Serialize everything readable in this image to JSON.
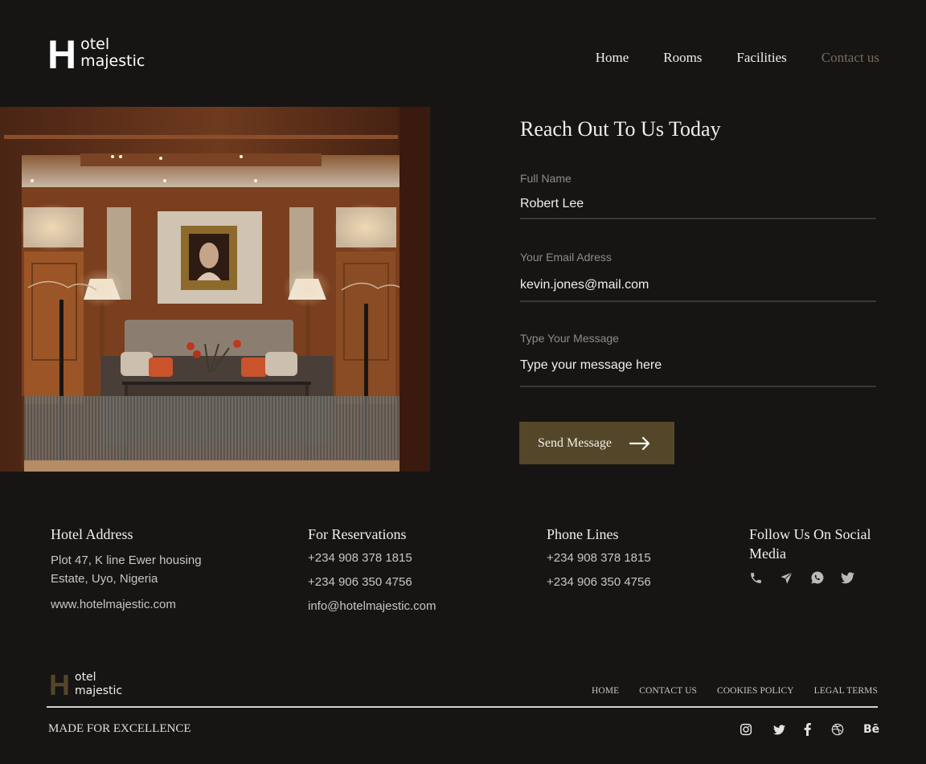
{
  "brand": {
    "logo_letter": "H",
    "logo_line1": "otel",
    "logo_line2": "majestic",
    "accent_color": "#544729",
    "active_nav_color": "#7a6a58",
    "background_color": "#161514"
  },
  "nav": {
    "items": [
      {
        "label": "Home",
        "active": false
      },
      {
        "label": "Rooms",
        "active": false
      },
      {
        "label": "Facilities",
        "active": false
      },
      {
        "label": "Contact us",
        "active": true
      }
    ]
  },
  "hero": {
    "image_description": "Warm wood-paneled hotel lobby with tufted sofa, portrait painting, lamps and console table",
    "icon": "hotel-lobby-photo"
  },
  "form": {
    "title": "Reach Out To Us Today",
    "fields": [
      {
        "label": "Full Name",
        "value": "Robert Lee",
        "placeholder": ""
      },
      {
        "label": "Your Email Adress",
        "value": "kevin.jones@mail.com",
        "placeholder": ""
      },
      {
        "label": "Type Your Message",
        "value": "",
        "placeholder": "Type your message here"
      }
    ],
    "submit_label": "Send Message",
    "submit_icon": "arrow-right-icon"
  },
  "info": {
    "address": {
      "title": "Hotel Address",
      "lines": [
        "Plot 47, K line Ewer housing Estate, Uyo, Nigeria"
      ],
      "website": "www.hotelmajestic.com"
    },
    "reservations": {
      "title": "For Reservations",
      "phone1": "+234 908 378 1815",
      "phone2": "+234 906 350 4756",
      "email": "info@hotelmajestic.com"
    },
    "phone_lines": {
      "title": "Phone Lines",
      "phone1": "+234 908 378 1815",
      "phone2": "+234 906 350 4756"
    },
    "social": {
      "title": "Follow Us On Social Media",
      "icons": [
        "phone-icon",
        "telegram-icon",
        "whatsapp-icon",
        "twitter-icon"
      ]
    }
  },
  "footer": {
    "links": [
      "HOME",
      "CONTACT US",
      "COOKIES POLICY",
      "LEGAL TERMS"
    ],
    "tagline": "MADE FOR EXCELLENCE",
    "social_icons": [
      "instagram-icon",
      "twitter-icon",
      "facebook-icon",
      "dribbble-icon",
      "behance-icon"
    ],
    "behance_label": "Bē"
  }
}
